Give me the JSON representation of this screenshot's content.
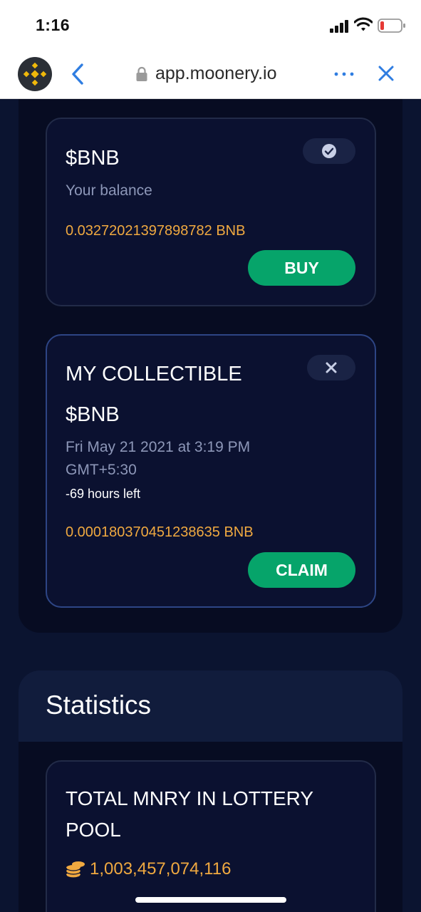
{
  "status_bar": {
    "time": "1:16"
  },
  "browser": {
    "url": "app.moonery.io"
  },
  "bnb_card": {
    "title": "$BNB",
    "balance_label": "Your balance",
    "balance_value": "0.03272021397898782 BNB",
    "buy_label": "BUY"
  },
  "collectible_card": {
    "heading": "MY COLLECTIBLE",
    "token": "$BNB",
    "date_line1": "Fri May 21 2021 at 3:19 PM",
    "date_line2": "GMT+5:30",
    "time_left": "-69 hours left",
    "amount": "0.000180370451238635 BNB",
    "claim_label": "CLAIM"
  },
  "statistics": {
    "title": "Statistics",
    "pool_card": {
      "title": "TOTAL MNRY IN LOTTERY POOL",
      "value": "1,003,457,074,116"
    }
  },
  "icons": {
    "logo": "binance-logo-icon",
    "back": "chevron-left-icon",
    "lock": "lock-icon",
    "more": "more-dots-icon",
    "close": "close-icon",
    "check": "check-circle-icon",
    "dismiss": "close-icon",
    "coins": "coins-icon"
  },
  "colors": {
    "accent_green": "#06a46a",
    "amount_orange": "#f0a940",
    "browser_blue": "#2f7de1",
    "background": "#0b1430"
  }
}
